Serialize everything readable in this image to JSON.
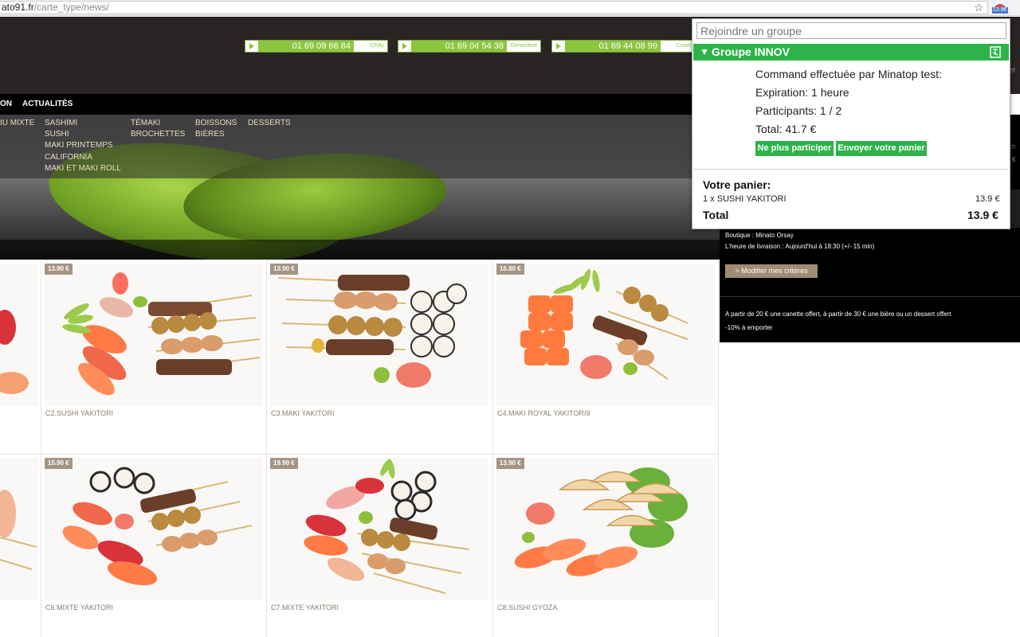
{
  "browser": {
    "url_host": "ato91.fr",
    "url_path": "/carte_type/news/",
    "extension_badge": "13.9€"
  },
  "header": {
    "phones": [
      {
        "number": "01 69 09 66 84",
        "city": "Chilly"
      },
      {
        "number": "01 69 04 54 38",
        "city": "Geneviève"
      },
      {
        "number": "01 69 44 08 99",
        "city": "Crosn"
      }
    ],
    "right_cut": "er"
  },
  "nav": {
    "items": [
      "ON",
      "ACTUALITÉS"
    ]
  },
  "menu": {
    "col0": [
      "IU MIXTE"
    ],
    "col1": [
      "SASHIMI",
      "SUSHI",
      "MAKI PRINTEMPS",
      "CALIFORNIA",
      "MAKI ET MAKI ROLL"
    ],
    "col2": [
      "TÉMAKI",
      "BROCHETTES"
    ],
    "col3": [
      "BOISSONS",
      "BIÈRES"
    ],
    "col4": [
      "DESSERTS"
    ]
  },
  "products": [
    {
      "price": "13.90 €",
      "name": "C2.SUSHI YAKITORI"
    },
    {
      "price": "13.90 €",
      "name": "C3.MAKI YAKITORI"
    },
    {
      "price": "16.80 €",
      "name": "C4.MAKI ROYAL YAKITORI9"
    },
    {
      "price": "15.90 €",
      "name": "C6.MIXTE YAKITORI"
    },
    {
      "price": "19.90 €",
      "name": "C7.MIXTE YAKITORI"
    },
    {
      "price": "13.90 €",
      "name": "C8.SUSHI GYOZA"
    }
  ],
  "sidebar": {
    "shop": "Boutique : Minato Orsay",
    "delivery": "L'heure de livraison : Aujourd'hui à 18:30 (+/- 15 min)",
    "modify_button": "> Modifier mes critères",
    "offer": "A partir de 20 € une canette offert, à partir de 30 € une bière ou un dessert offert",
    "takeaway": "-10% à emporter"
  },
  "popup": {
    "join_placeholder": "Rejoindre un groupe",
    "group_name": "Groupe INNOV",
    "order_by": "Command effectuée par Minatop test:",
    "expiration": "Expiration: 1 heure",
    "participants": "Participants: 1 / 2",
    "total": "Total: 41.7 €",
    "leave_button": "Ne plus participer",
    "send_button": "Envoyer votre panier",
    "cart_title": "Votre panier:",
    "cart_item": "1 x SUSHI YAKITORI",
    "cart_item_price": "13.9 €",
    "cart_total_label": "Total",
    "cart_total_value": "13.9 €"
  },
  "colors": {
    "brand_green": "#2eb34a",
    "phone_green": "#8cc63f",
    "price_tag": "#a59484",
    "header_bg": "#292524"
  }
}
